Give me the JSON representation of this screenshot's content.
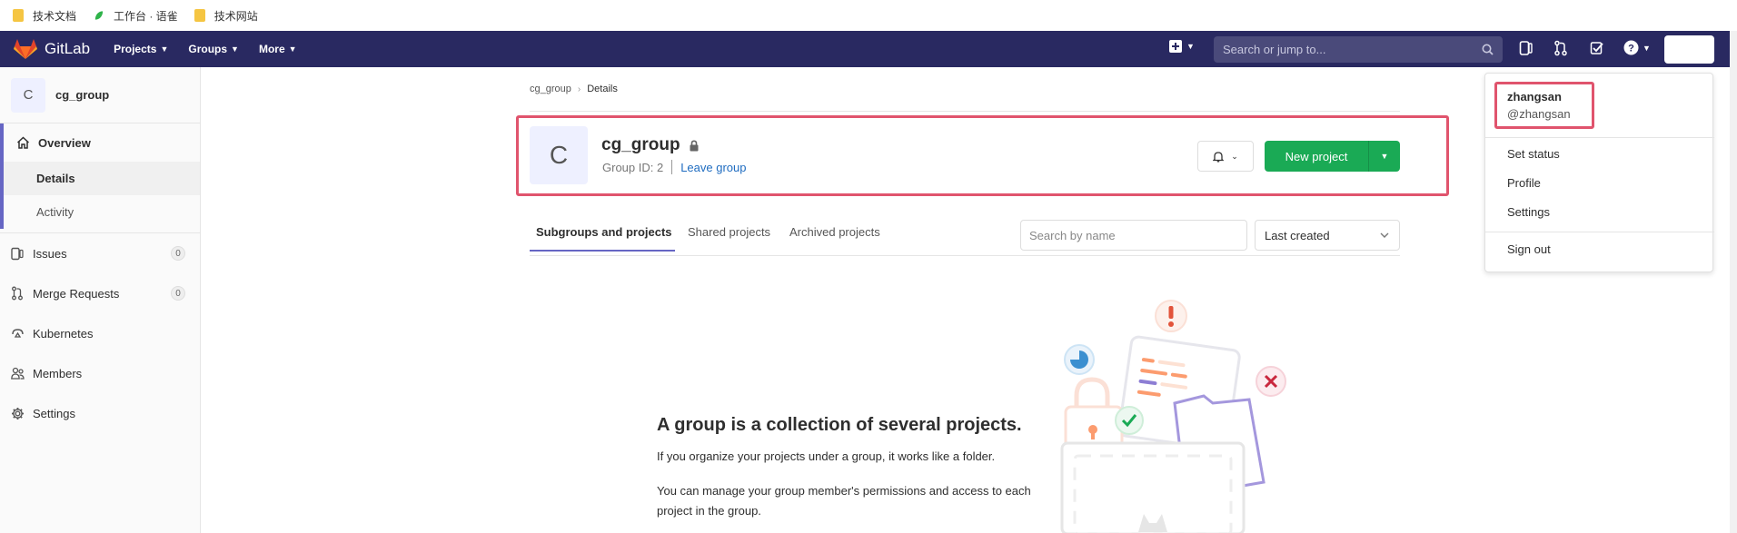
{
  "bookmarks": [
    {
      "label": "技术文档",
      "icon": "folder-icon"
    },
    {
      "label": "工作台 · 语雀",
      "icon": "yuque-icon"
    },
    {
      "label": "技术网站",
      "icon": "folder-icon"
    }
  ],
  "navbar": {
    "brand": "GitLab",
    "menus": [
      "Projects",
      "Groups",
      "More"
    ],
    "search_placeholder": "Search or jump to..."
  },
  "sidebar": {
    "group_initial": "C",
    "group_name": "cg_group",
    "overview": "Overview",
    "overview_sub": [
      "Details",
      "Activity"
    ],
    "items": [
      {
        "label": "Issues",
        "count": "0",
        "icon": "issues-icon"
      },
      {
        "label": "Merge Requests",
        "count": "0",
        "icon": "merge-request-icon"
      },
      {
        "label": "Kubernetes",
        "icon": "kubernetes-icon"
      },
      {
        "label": "Members",
        "icon": "members-icon"
      },
      {
        "label": "Settings",
        "icon": "settings-icon"
      }
    ]
  },
  "breadcrumb": {
    "parent": "cg_group",
    "current": "Details"
  },
  "group": {
    "initial": "C",
    "name": "cg_group",
    "id_text": "Group ID: 2",
    "leave": "Leave group",
    "new_project": "New project"
  },
  "tabs": [
    "Subgroups and projects",
    "Shared projects",
    "Archived projects"
  ],
  "filter": {
    "placeholder": "Search by name",
    "sort": "Last created"
  },
  "empty_state": {
    "title": "A group is a collection of several projects.",
    "p1": "If you organize your projects under a group, it works like a folder.",
    "p2": "You can manage your group member's permissions and access to each project in the group."
  },
  "user_menu": {
    "name": "zhangsan",
    "handle": "@zhangsan",
    "items": [
      "Set status",
      "Profile",
      "Settings",
      "Sign out"
    ]
  },
  "colors": {
    "navbar": "#292961",
    "primary_green": "#1aaa55",
    "highlight_red": "#e0546d",
    "active_indigo": "#6666c4"
  }
}
